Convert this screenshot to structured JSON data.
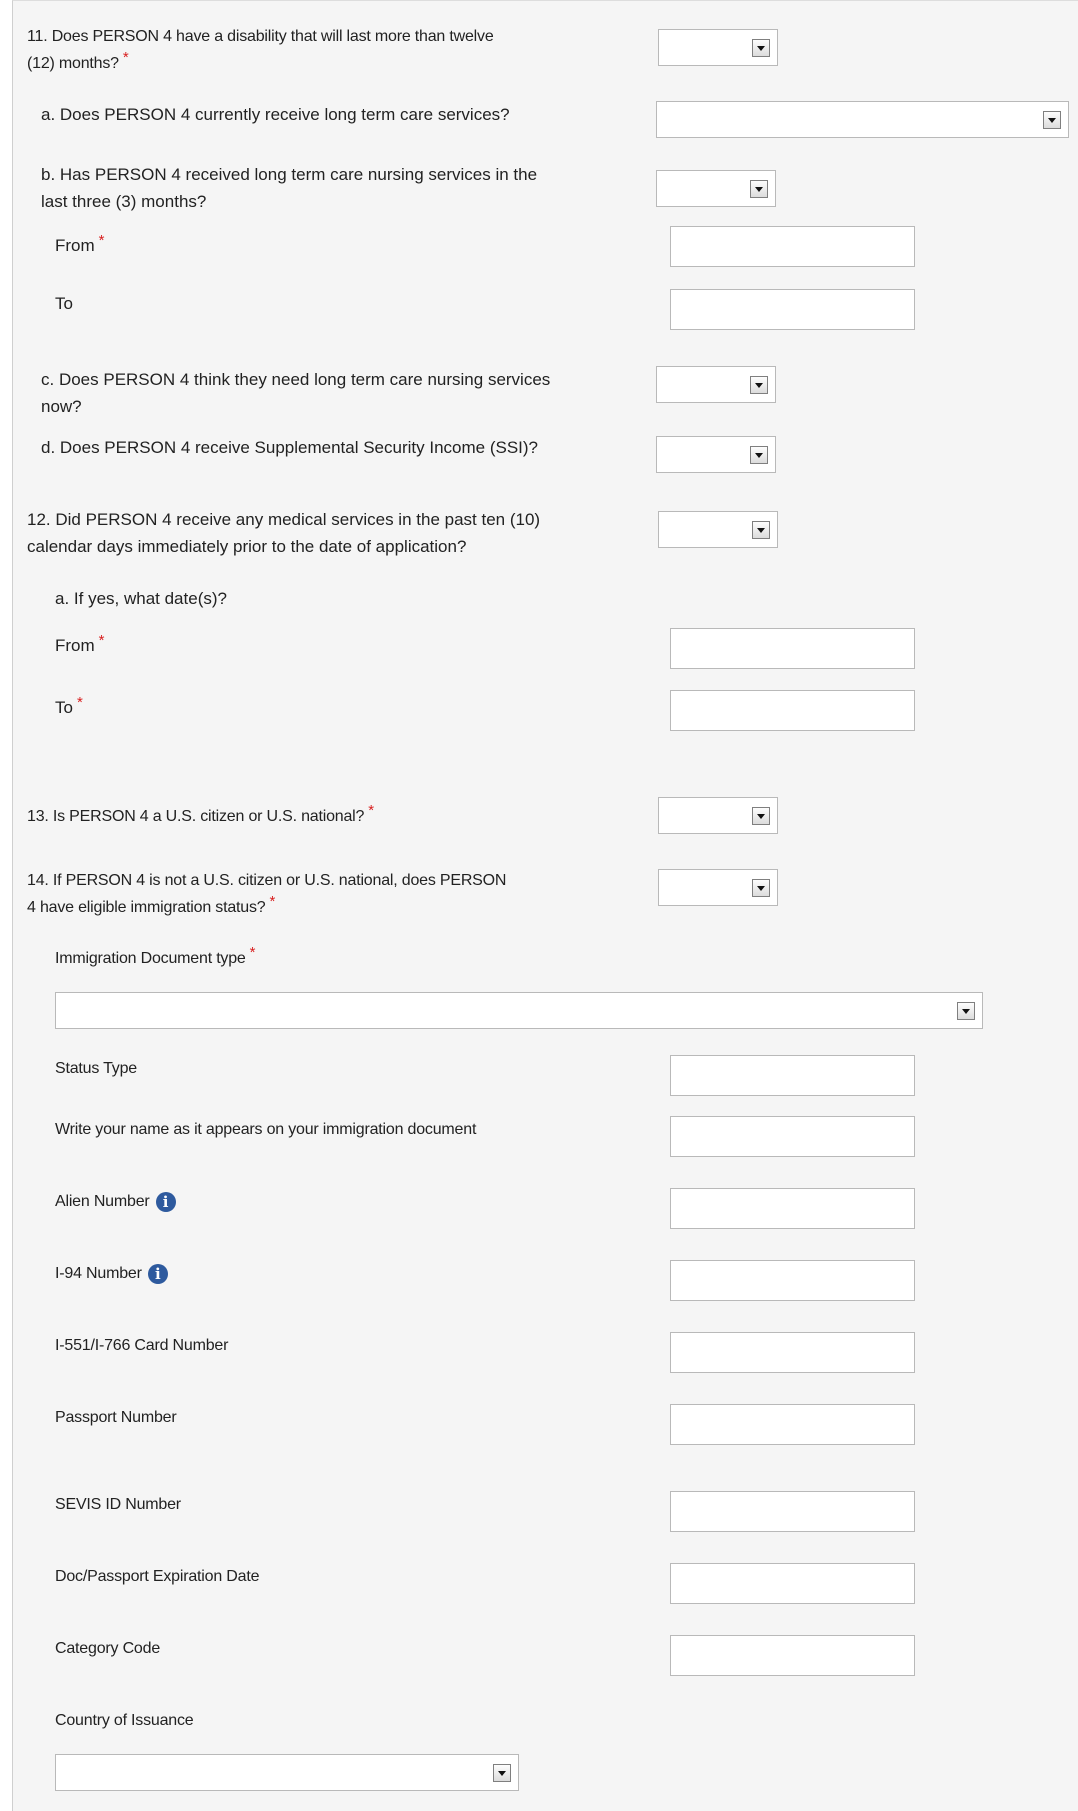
{
  "q11": {
    "label_line1": "11. Does PERSON 4 have a disability that will last more than twelve",
    "label_line2": "(12) months?",
    "a": "a. Does PERSON 4 currently receive long term care services?",
    "b_line1": "b. Has PERSON 4 received long term care nursing services in the",
    "b_line2": "last three (3) months?",
    "from_label": "From",
    "to_label": "To",
    "c_line1": "c. Does PERSON 4 think they need long term care nursing services",
    "c_line2": "now?",
    "d": "d. Does PERSON 4 receive Supplemental Security Income (SSI)?"
  },
  "q12": {
    "label_line1": "12. Did PERSON 4 receive any medical services in the past ten (10)",
    "label_line2": "calendar days immediately prior to the date of application?",
    "a": "a. If yes, what date(s)?",
    "from_label": "From",
    "to_label": "To"
  },
  "q13": {
    "label": "13. Is PERSON 4 a U.S. citizen or U.S. national?"
  },
  "q14": {
    "label_line1": "14. If PERSON 4 is not a U.S. citizen or U.S. national, does PERSON",
    "label_line2": "4 have eligible immigration status?",
    "doc_type_label": "Immigration Document type",
    "status_type_label": "Status Type",
    "name_label": "Write your name as it appears on your immigration document",
    "alien_number_label": "Alien Number",
    "i94_label": "I-94 Number",
    "card_number_label": "I-551/I-766 Card Number",
    "passport_label": "Passport Number",
    "sevis_label": "SEVIS ID Number",
    "expiration_label": "Doc/Passport Expiration Date",
    "category_label": "Category Code",
    "country_label": "Country of Issuance"
  },
  "required_marker": "*",
  "info_glyph": "i",
  "colors": {
    "required": "#d81e1e",
    "info": "#2e5a9e",
    "panel": "#f5f5f5"
  }
}
